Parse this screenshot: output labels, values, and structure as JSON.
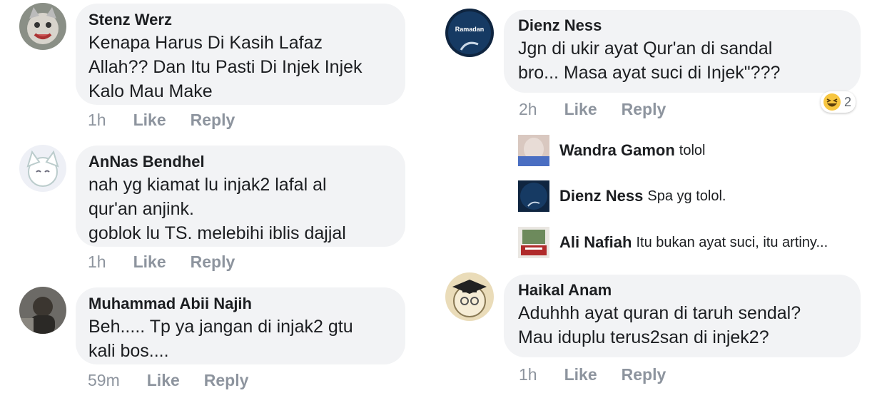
{
  "left": [
    {
      "name": "Stenz Werz",
      "text": "Kenapa Harus Di Kasih Lafaz\nAllah?? Dan Itu Pasti Di Injek Injek\nKalo Mau Make",
      "time": "1h",
      "like": "Like",
      "reply": "Reply"
    },
    {
      "name": "AnNas Bendhel",
      "text": "nah yg kiamat lu injak2 lafal al\nqur'an anjink.\ngoblok lu TS. melebihi iblis dajjal",
      "time": "1h",
      "like": "Like",
      "reply": "Reply"
    },
    {
      "name": "Muhammad Abii Najih",
      "text": "Beh..... Tp ya jangan di injak2 gtu\nkali bos....",
      "time": "59m",
      "like": "Like",
      "reply": "Reply"
    }
  ],
  "right": {
    "main": {
      "name": "Dienz Ness",
      "text": "Jgn di ukir ayat Qur'an di sandal\nbro...  Masa ayat suci di Injek\"???",
      "time": "2h",
      "like": "Like",
      "reply": "Reply",
      "reaction_count": "2",
      "reaction_icon": "haha-emoji-icon",
      "avatar_text": "Ramadan"
    },
    "replies": [
      {
        "name": "Wandra Gamon",
        "text": "tolol"
      },
      {
        "name": "Dienz Ness",
        "text": "Spa yg tolol."
      },
      {
        "name": "Ali Nafiah",
        "text": "Itu bukan ayat suci, itu artiny..."
      }
    ],
    "second": {
      "name": "Haikal Anam",
      "text": "Aduhhh ayat quran di taruh sendal?\nMau iduplu terus2san di injek2?",
      "time": "1h",
      "like": "Like",
      "reply": "Reply"
    }
  }
}
